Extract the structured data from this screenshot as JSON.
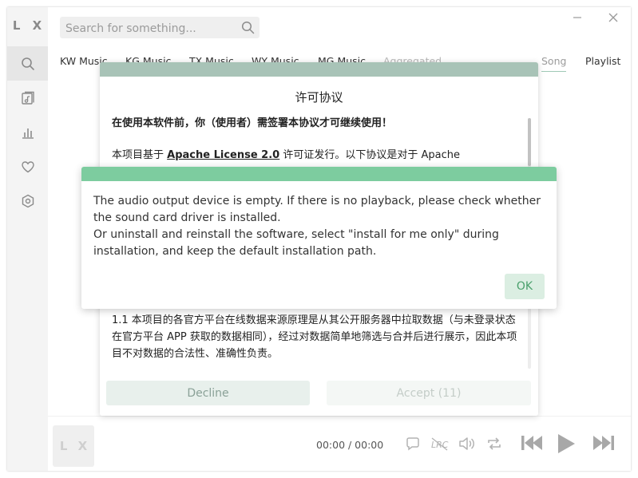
{
  "app": {
    "logo": "L X"
  },
  "search": {
    "placeholder": "Search for something..."
  },
  "tabs": {
    "items": [
      {
        "label": "KW Music"
      },
      {
        "label": "KG Music"
      },
      {
        "label": "TX Music"
      },
      {
        "label": "WY Music"
      },
      {
        "label": "MG Music"
      },
      {
        "label": "Aggregated"
      }
    ],
    "song": "Song",
    "playlist": "Playlist"
  },
  "license": {
    "title": "许可协议",
    "bold_line": "在使用本软件前，你（使用者）需签署本协议才可继续使用！",
    "p2_before": "本项目基于 ",
    "p2_link": "Apache License 2.0",
    "p2_after": " 许可证发行。以下协议是对于 Apache",
    "p3": "1.1 本项目的各官方平台在线数据来源原理是从其公开服务器中拉取数据（与未登录状态在官方平台 APP 获取的数据相同），经过对数据简单地筛选与合并后进行展示，因此本项目不对数据的合法性、准确性负责。",
    "decline": "Decline",
    "accept": "Accept (11)"
  },
  "alert": {
    "line1": "The audio output device is empty. If there is no playback, please check whether the sound card driver is installed.",
    "line2": "Or uninstall and reinstall the software, select \"install for me only\" during installation, and keep the default installation path.",
    "ok": "OK"
  },
  "player": {
    "art_text": "L X",
    "time": "00:00 / 00:00"
  },
  "colors": {
    "accent": "#7dcc9f",
    "license_header": "#a8c3b7"
  }
}
